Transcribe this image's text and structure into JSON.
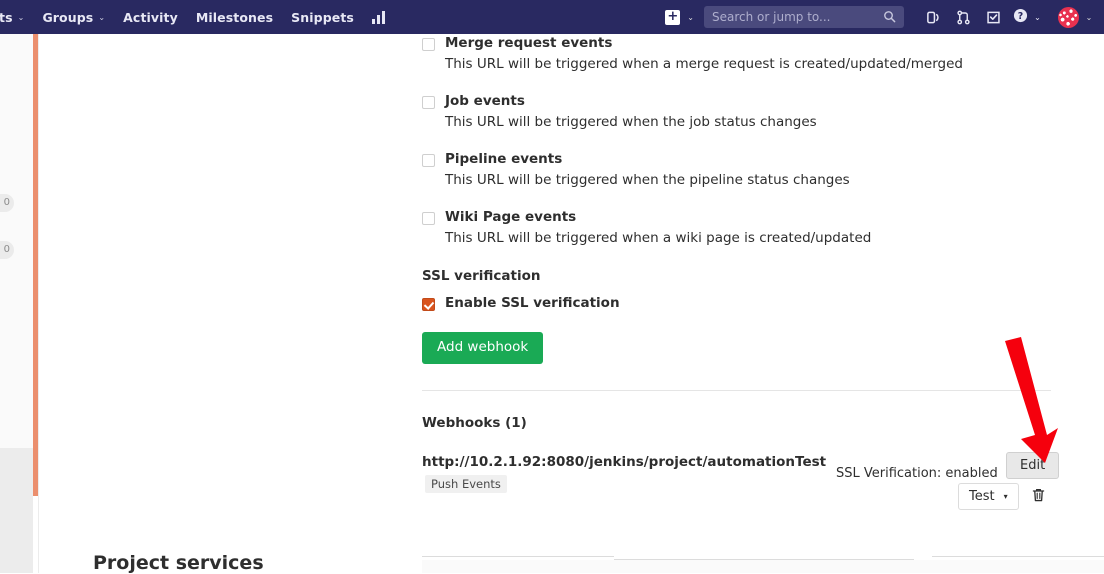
{
  "navbar": {
    "left_items": [
      {
        "label": "ts",
        "caret": "⌄",
        "name": "nav-projects-truncated"
      },
      {
        "label": "Groups",
        "caret": "⌄",
        "name": "nav-groups"
      },
      {
        "label": "Activity",
        "caret": "",
        "name": "nav-activity"
      },
      {
        "label": "Milestones",
        "caret": "",
        "name": "nav-milestones"
      },
      {
        "label": "Snippets",
        "caret": "",
        "name": "nav-snippets"
      }
    ],
    "chart_icon_name": "analytics-chart-icon",
    "create_plus": "+",
    "create_caret": "⌄",
    "search": {
      "placeholder": "Search or jump to...",
      "value": ""
    },
    "icons": [
      {
        "name": "issues-icon",
        "title": "Issues"
      },
      {
        "name": "merge-requests-icon",
        "title": "Merge requests"
      },
      {
        "name": "todos-icon",
        "title": "To-Do List"
      },
      {
        "name": "help-icon",
        "title": "Help"
      }
    ],
    "help_caret": "⌄",
    "avatar_caret": "⌄",
    "bg_color": "#292961"
  },
  "sidebar": {
    "badges": [
      {
        "text": "0"
      },
      {
        "text": "0"
      }
    ],
    "accent_color": "#eb8f6e"
  },
  "events": [
    {
      "title": "Merge request events",
      "description": "This URL will be triggered when a merge request is created/updated/merged",
      "checked": false,
      "name": "merge-request-events"
    },
    {
      "title": "Job events",
      "description": "This URL will be triggered when the job status changes",
      "checked": false,
      "name": "job-events"
    },
    {
      "title": "Pipeline events",
      "description": "This URL will be triggered when the pipeline status changes",
      "checked": false,
      "name": "pipeline-events"
    },
    {
      "title": "Wiki Page events",
      "description": "This URL will be triggered when a wiki page is created/updated",
      "checked": false,
      "name": "wiki-page-events"
    }
  ],
  "ssl": {
    "heading": "SSL verification",
    "checkbox_label": "Enable SSL verification",
    "checked": true,
    "checked_color": "#d9541e"
  },
  "add_webhook_button": {
    "label": "Add webhook",
    "color": "#1aaa55"
  },
  "webhooks": {
    "heading": "Webhooks (1)",
    "items": [
      {
        "url": "http://10.2.1.92:8080/jenkins/project/automationTest",
        "badge": "Push Events",
        "ssl_status": "SSL Verification: enabled",
        "edit_label": "Edit",
        "test_label": "Test",
        "test_caret": "▾",
        "delete_icon_name": "trash-icon"
      }
    ]
  },
  "project_services": {
    "heading": "Project services"
  },
  "annotation": {
    "arrow_color": "#f5000d",
    "name": "red-pointer-arrow"
  }
}
